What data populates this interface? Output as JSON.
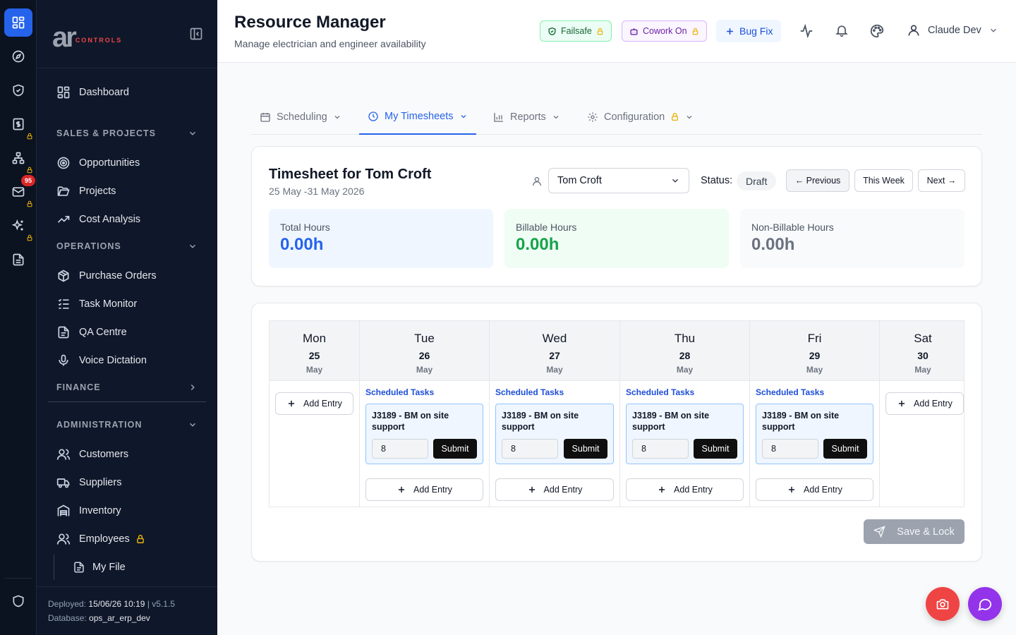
{
  "rail": {
    "badge_count": "95"
  },
  "brand": {
    "logo_main": "ar",
    "logo_sub": "CONTROLS"
  },
  "nav": {
    "dashboard": "Dashboard",
    "sales_section": "SALES & PROJECTS",
    "opportunities": "Opportunities",
    "projects": "Projects",
    "cost_analysis": "Cost Analysis",
    "operations_section": "OPERATIONS",
    "purchase_orders": "Purchase Orders",
    "task_monitor": "Task Monitor",
    "qa_centre": "QA Centre",
    "voice_dictation": "Voice Dictation",
    "finance_section": "FINANCE",
    "admin_section": "ADMINISTRATION",
    "customers": "Customers",
    "suppliers": "Suppliers",
    "inventory": "Inventory",
    "employees": "Employees",
    "my_file": "My File"
  },
  "footer": {
    "deployed_label": "Deployed:",
    "deployed_value": "15/06/26 10:19",
    "version_sep": "|",
    "version": "v5.1.5",
    "database_label": "Database:",
    "database_value": "ops_ar_erp_dev"
  },
  "header": {
    "title": "Resource Manager",
    "subtitle": "Manage electrician and engineer availability",
    "failsafe": "Failsafe",
    "cowork": "Cowork On",
    "bugfix": "Bug Fix",
    "user": "Claude Dev"
  },
  "tabs": {
    "scheduling": "Scheduling",
    "timesheets": "My Timesheets",
    "reports": "Reports",
    "configuration": "Configuration"
  },
  "timesheet": {
    "title": "Timesheet for Tom Croft",
    "range": "25 May -31 May 2026",
    "employee": "Tom Croft",
    "status_label": "Status:",
    "status_value": "Draft",
    "prev": "← Previous",
    "this_week": "This Week",
    "next": "Next →",
    "total_label": "Total Hours",
    "total_value": "0.00h",
    "billable_label": "Billable Hours",
    "billable_value": "0.00h",
    "nonbillable_label": "Non-Billable Hours",
    "nonbillable_value": "0.00h"
  },
  "colors": {
    "accent": "#2563eb",
    "billable": "#16a34a",
    "danger": "#ef4444",
    "purple": "#9333ea"
  },
  "days": [
    {
      "name": "Mon",
      "num": "25",
      "month": "May",
      "add": "Add Entry"
    },
    {
      "name": "Tue",
      "num": "26",
      "month": "May",
      "add": "Add Entry",
      "sched": "Scheduled Tasks",
      "task": "J3189 - BM on site support",
      "hours": "8",
      "submit": "Submit"
    },
    {
      "name": "Wed",
      "num": "27",
      "month": "May",
      "add": "Add Entry",
      "sched": "Scheduled Tasks",
      "task": "J3189 - BM on site support",
      "hours": "8",
      "submit": "Submit"
    },
    {
      "name": "Thu",
      "num": "28",
      "month": "May",
      "add": "Add Entry",
      "sched": "Scheduled Tasks",
      "task": "J3189 - BM on site support",
      "hours": "8",
      "submit": "Submit"
    },
    {
      "name": "Fri",
      "num": "29",
      "month": "May",
      "add": "Add Entry",
      "sched": "Scheduled Tasks",
      "task": "J3189 - BM on site support",
      "hours": "8",
      "submit": "Submit"
    },
    {
      "name": "Sat",
      "num": "30",
      "month": "May",
      "add": "Add Entry"
    }
  ],
  "save_label": "Save & Lock"
}
